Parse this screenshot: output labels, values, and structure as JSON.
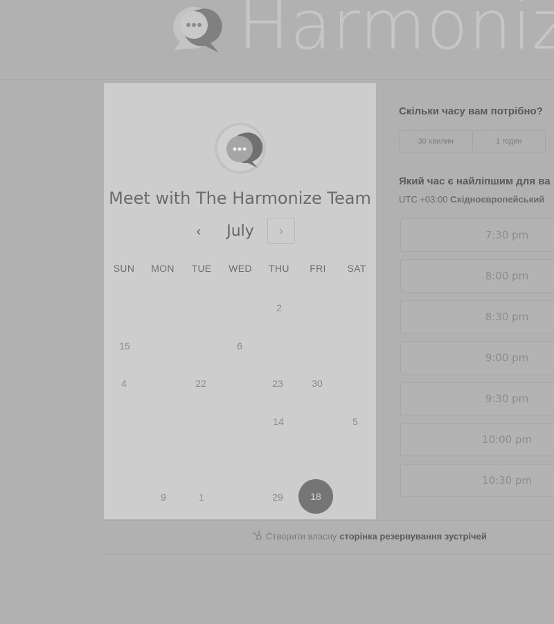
{
  "brand": {
    "name": "Harmoniz",
    "logo_icon": "chat-bubble-logo-icon"
  },
  "card": {
    "title": "Meet with The Harmonize Team",
    "profile_icon": "chat-bubble-logo-icon",
    "month": "July",
    "prev_label": "‹",
    "next_label": "›",
    "weekdays": [
      "SUN",
      "MON",
      "TUE",
      "WED",
      "THU",
      "FRI",
      "SAT"
    ],
    "days": {
      "d2": "2",
      "d15": "15",
      "d6": "6",
      "d4": "4",
      "d22": "22",
      "d23": "23",
      "d30": "30",
      "d14": "14",
      "d5": "5",
      "d9": "9",
      "d1": "1",
      "d29": "29"
    },
    "selected_day": "18"
  },
  "booking": {
    "duration_question": "Скільки часу вам потрібно?",
    "durations": [
      "30 хвилин",
      "1 годин"
    ],
    "time_question": "Який час є найліпшим для ва",
    "tz_offset": "UTC +03:00 ",
    "tz_name": "Східноєвропейський",
    "slots": [
      "7:30 pm",
      "8:00 pm",
      "8:30 pm",
      "9:00 pm",
      "9:30 pm",
      "10:00 pm",
      "10:30 pm"
    ]
  },
  "footer": {
    "prefix": "Створити власну",
    "link": "сторінка резервування зустрічей",
    "icon": "sprocket-icon"
  },
  "colors": {
    "background": "#b1b1b1",
    "card": "#cdcdcd",
    "selected": "#757575"
  }
}
